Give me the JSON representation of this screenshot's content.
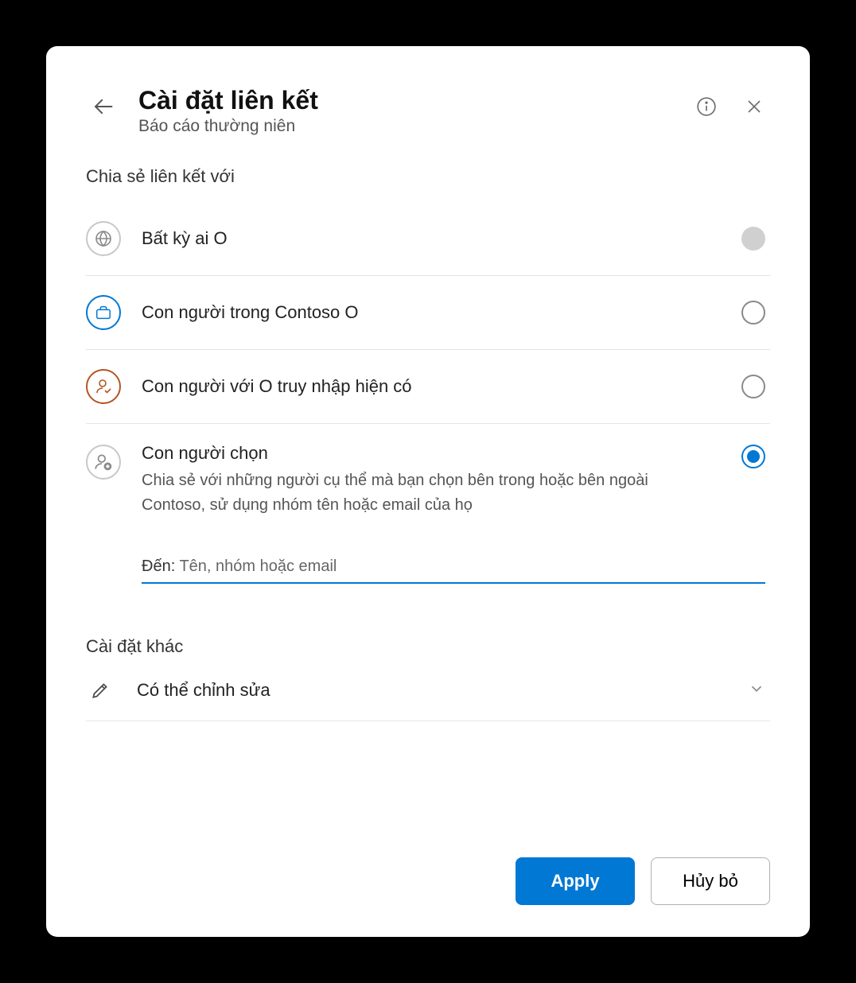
{
  "header": {
    "title": "Cài đặt liên kết",
    "subtitle": "Báo cáo thường niên"
  },
  "share_section_label": "Chia sẻ liên kết với",
  "options": {
    "anyone": {
      "label": "Bất kỳ ai O"
    },
    "org": {
      "label": "Con người trong Contoso O"
    },
    "existing": {
      "label": "Con người với O truy nhập hiện có"
    },
    "chosen": {
      "label": "Con người chọn",
      "desc": "Chia sẻ với những người cụ thể mà bạn chọn bên trong hoặc bên ngoài Contoso, sử dụng nhóm tên hoặc email của họ"
    }
  },
  "to_field": {
    "prefix": "Đến:",
    "placeholder": "Tên, nhóm hoặc email"
  },
  "more": {
    "section_label": "Cài đặt khác",
    "permission": "Có thể chỉnh sửa"
  },
  "footer": {
    "apply": "Apply",
    "cancel": "Hủy bỏ"
  }
}
